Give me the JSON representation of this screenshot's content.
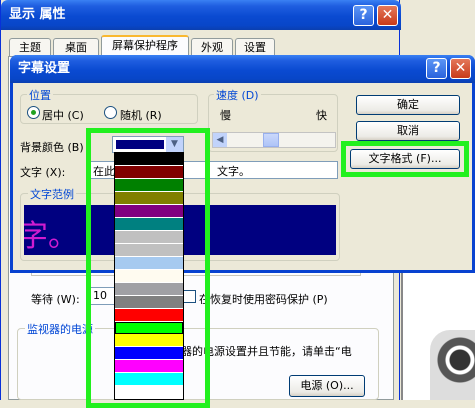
{
  "back_window": {
    "title": "显示 属性",
    "tabs": [
      "主题",
      "桌面",
      "屏幕保护程序",
      "外观",
      "设置"
    ],
    "wait_label": "等待 (W):",
    "wait_value": "10",
    "password_label": "在恢复时使用密码保护 (P)",
    "monitor_group": "监视器的电源",
    "monitor_text": "器的电源设置并且节能，请单击“电",
    "power_button": "电源 (O)..."
  },
  "dialog": {
    "title": "字幕设置",
    "position_group": "位置",
    "center_label": "居中 (C)",
    "random_label": "随机 (R)",
    "speed_group": "速度 (D)",
    "speed_slow": "慢",
    "speed_fast": "快",
    "ok_button": "确定",
    "cancel_button": "取消",
    "format_button": "文字格式 (F)...",
    "bg_color_label": "背景颜色 (B)",
    "text_label": "文字 (X):",
    "text_value": "在此",
    "text_value_tail": "文字。",
    "preview_group": "文字范例",
    "preview_text": "字。"
  },
  "colors": {
    "selected": "#000080",
    "palette": [
      "#000000",
      "#800000",
      "#008000",
      "#808000",
      "#800080",
      "#008080",
      "#c0c0c0",
      "#c0c0c0",
      "#a6caf0",
      "#fffbf0",
      "#a0a0a4",
      "#808080",
      "#ff0000",
      "#00ff00",
      "#ffff00",
      "#0000ff",
      "#ff00ff",
      "#00ffff"
    ],
    "highlight": "#22f01e",
    "preview_bg": "#000080",
    "preview_fg": "#d01cd0"
  }
}
